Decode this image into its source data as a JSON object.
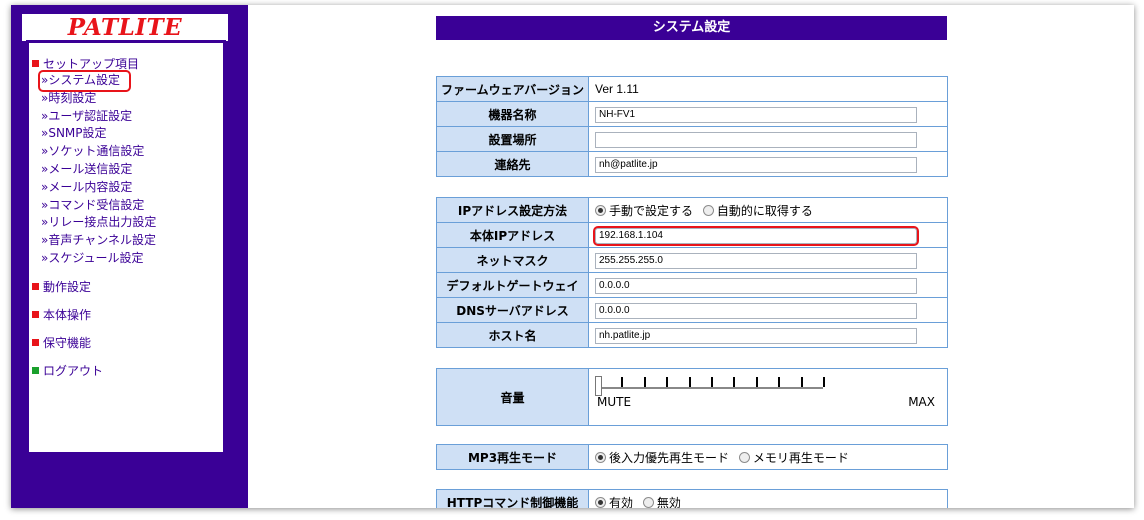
{
  "sidebar": {
    "logo": "PATLITE",
    "setup_title": "セットアップ項目",
    "setup_items": [
      "»システム設定",
      "»時刻設定",
      "»ユーザ認証設定",
      "»SNMP設定",
      "»ソケット通信設定",
      "»メール送信設定",
      "»メール内容設定",
      "»コマンド受信設定",
      "»リレー接点出力設定",
      "»音声チャンネル設定",
      "»スケジュール設定"
    ],
    "selected_item": "»システム設定",
    "sections": [
      "動作設定",
      "本体操作",
      "保守機能"
    ],
    "logout": "ログアウト"
  },
  "main": {
    "title": "システム設定",
    "firmware": {
      "label": "ファームウェアバージョン",
      "value": "Ver 1.11"
    },
    "device_name": {
      "label": "機器名称",
      "value": "NH-FV1"
    },
    "location": {
      "label": "設置場所",
      "value": ""
    },
    "contact": {
      "label": "連絡先",
      "value": "nh@patlite.jp"
    },
    "ip_method": {
      "label": "IPアドレス設定方法",
      "options": [
        "手動で設定する",
        "自動的に取得する"
      ],
      "selected": "手動で設定する"
    },
    "ip_address": {
      "label": "本体IPアドレス",
      "value": "192.168.1.104"
    },
    "netmask": {
      "label": "ネットマスク",
      "value": "255.255.255.0"
    },
    "gateway": {
      "label": "デフォルトゲートウェイ",
      "value": "0.0.0.0"
    },
    "dns": {
      "label": "DNSサーバアドレス",
      "value": "0.0.0.0"
    },
    "hostname": {
      "label": "ホスト名",
      "value": "nh.patlite.jp"
    },
    "volume": {
      "label": "音量",
      "min_label": "MUTE",
      "max_label": "MAX",
      "level": 0
    },
    "mp3_mode": {
      "label": "MP3再生モード",
      "options": [
        "後入力優先再生モード",
        "メモリ再生モード"
      ],
      "selected": "後入力優先再生モード"
    },
    "http_cmd": {
      "label": "HTTPコマンド制御機能",
      "options": [
        "有効",
        "無効"
      ],
      "selected": "有効"
    }
  },
  "colors": {
    "brand": "#3a0096",
    "accent": "#e8141a",
    "label_bg": "#cfe0f5",
    "border": "#6a9fd8"
  }
}
